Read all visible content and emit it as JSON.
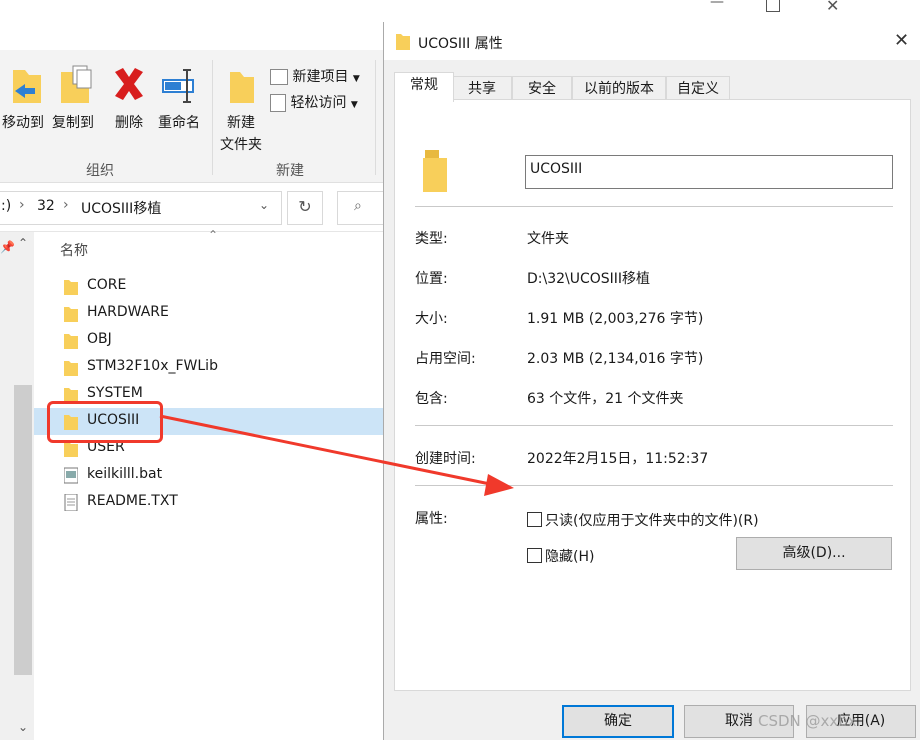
{
  "explorer": {
    "ribbon": {
      "move_to": "移动到",
      "copy_to": "复制到",
      "delete": "删除",
      "rename": "重命名",
      "new_folder_line1": "新建",
      "new_folder_line2": "文件夹",
      "new_item": "新建项目",
      "easy_access": "轻松访问",
      "group_organize": "组织",
      "group_new": "新建"
    },
    "address": {
      "crumb_drive": ":)",
      "crumb_32": "32",
      "crumb_current": "UCOSIII移植"
    },
    "column_header": "名称",
    "files": [
      {
        "name": "CORE",
        "type": "folder"
      },
      {
        "name": "HARDWARE",
        "type": "folder"
      },
      {
        "name": "OBJ",
        "type": "folder"
      },
      {
        "name": "STM32F10x_FWLib",
        "type": "folder"
      },
      {
        "name": "SYSTEM",
        "type": "folder"
      },
      {
        "name": "UCOSIII",
        "type": "folder",
        "selected": true
      },
      {
        "name": "USER",
        "type": "folder"
      },
      {
        "name": "keilkilll.bat",
        "type": "bat"
      },
      {
        "name": "README.TXT",
        "type": "txt"
      }
    ]
  },
  "dialog": {
    "title": "UCOSIII 属性",
    "tabs": [
      "常规",
      "共享",
      "安全",
      "以前的版本",
      "自定义"
    ],
    "name_value": "UCOSIII",
    "props": {
      "type_label": "类型:",
      "type_value": "文件夹",
      "location_label": "位置:",
      "location_value": "D:\\32\\UCOSIII移植",
      "size_label": "大小:",
      "size_value": "1.91 MB (2,003,276 字节)",
      "disk_label": "占用空间:",
      "disk_value": "2.03 MB (2,134,016 字节)",
      "contains_label": "包含:",
      "contains_value": "63 个文件，21 个文件夹",
      "created_label": "创建时间:",
      "created_value": "2022年2月15日，11:52:37",
      "attr_label": "属性:"
    },
    "readonly_label": "只读(仅应用于文件夹中的文件)(R)",
    "hidden_label": "隐藏(H)",
    "advanced_label": "高级(D)...",
    "ok_label": "确定",
    "cancel_label": "取消",
    "apply_label": "应用(A)"
  },
  "watermark": "CSDN @xxbx",
  "colors": {
    "accent": "#0078d7",
    "annotation": "#f0392b",
    "folder": "#f8cf5a",
    "selection": "#cce4f7"
  }
}
